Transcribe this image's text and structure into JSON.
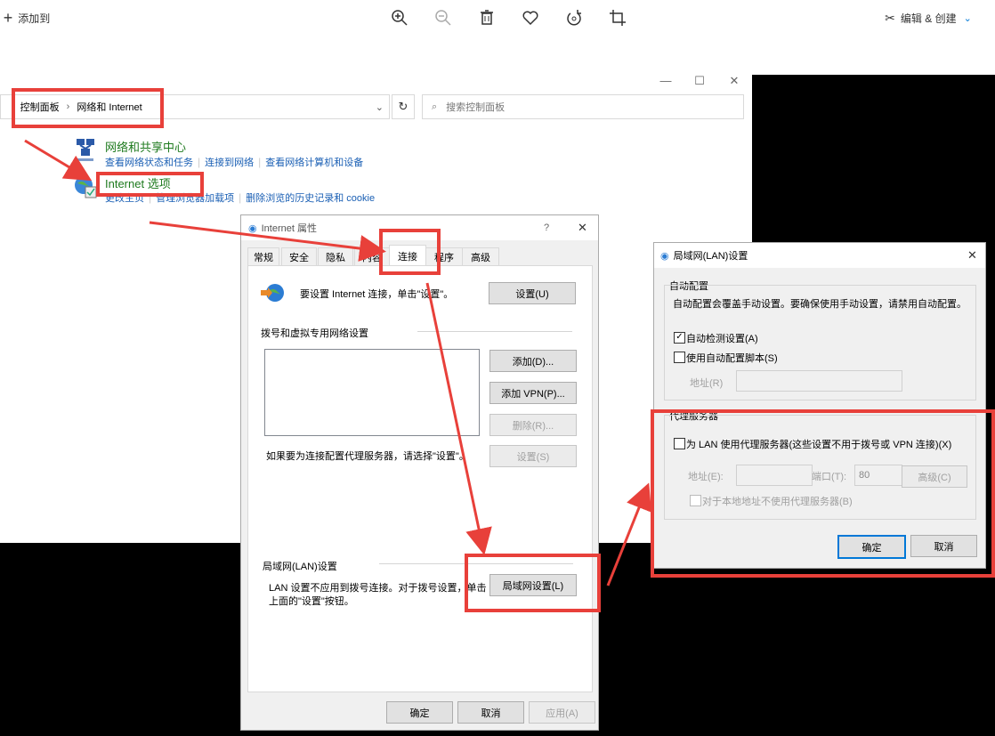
{
  "viewer": {
    "add_to": "添加到",
    "edit_create": "编辑 & 创建",
    "icons": [
      "zoom-in-icon",
      "zoom-out-icon",
      "delete-icon",
      "heart-icon",
      "rotate-icon",
      "crop-icon"
    ]
  },
  "control_panel": {
    "breadcrumb": [
      "控制面板",
      "网络和 Internet"
    ],
    "search_placeholder": "搜索控制面板",
    "sections": [
      {
        "title": "网络和共享中心",
        "links": [
          "查看网络状态和任务",
          "连接到网络",
          "查看网络计算机和设备"
        ]
      },
      {
        "title": "Internet 选项",
        "links": [
          "更改主页",
          "管理浏览器加载项",
          "删除浏览的历史记录和 cookie"
        ]
      }
    ]
  },
  "internet_props": {
    "title": "Internet 属性",
    "help": "?",
    "tabs": [
      "常规",
      "安全",
      "隐私",
      "内容",
      "连接",
      "程序",
      "高级"
    ],
    "active_tab": "连接",
    "setup_text": "要设置 Internet 连接，单击\"设置\"。",
    "setup_button": "设置(U)",
    "dialup_group": "拨号和虚拟专用网络设置",
    "add_button": "添加(D)...",
    "add_vpn_button": "添加 VPN(P)...",
    "delete_button": "删除(R)...",
    "settings_button": "设置(S)",
    "proxy_hint": "如果要为连接配置代理服务器，请选择\"设置\"。",
    "lan_group": "局域网(LAN)设置",
    "lan_desc_1": "LAN 设置不应用到拨号连接。对于拨号设置，单击",
    "lan_desc_2": "上面的\"设置\"按钮。",
    "lan_button": "局域网设置(L)",
    "ok": "确定",
    "cancel": "取消",
    "apply": "应用(A)"
  },
  "lan_settings": {
    "title": "局域网(LAN)设置",
    "auto_group": "自动配置",
    "auto_desc": "自动配置会覆盖手动设置。要确保使用手动设置，请禁用自动配置。",
    "auto_detect": "自动检测设置(A)",
    "auto_detect_checked": true,
    "auto_script": "使用自动配置脚本(S)",
    "auto_script_checked": false,
    "address_label": "地址(R)",
    "proxy_group": "代理服务器",
    "use_proxy": "为 LAN 使用代理服务器(这些设置不用于拨号或 VPN 连接)(X)",
    "use_proxy_checked": false,
    "proxy_address_label": "地址(E):",
    "port_label": "端口(T):",
    "port_value": "80",
    "advanced_button": "高级(C)",
    "bypass_local": "对于本地地址不使用代理服务器(B)",
    "ok": "确定",
    "cancel": "取消"
  },
  "colors": {
    "accent": "#0078d7",
    "annotation": "#e8403a",
    "link": "#1a5fb4",
    "heading_green": "#1e7a1e"
  }
}
